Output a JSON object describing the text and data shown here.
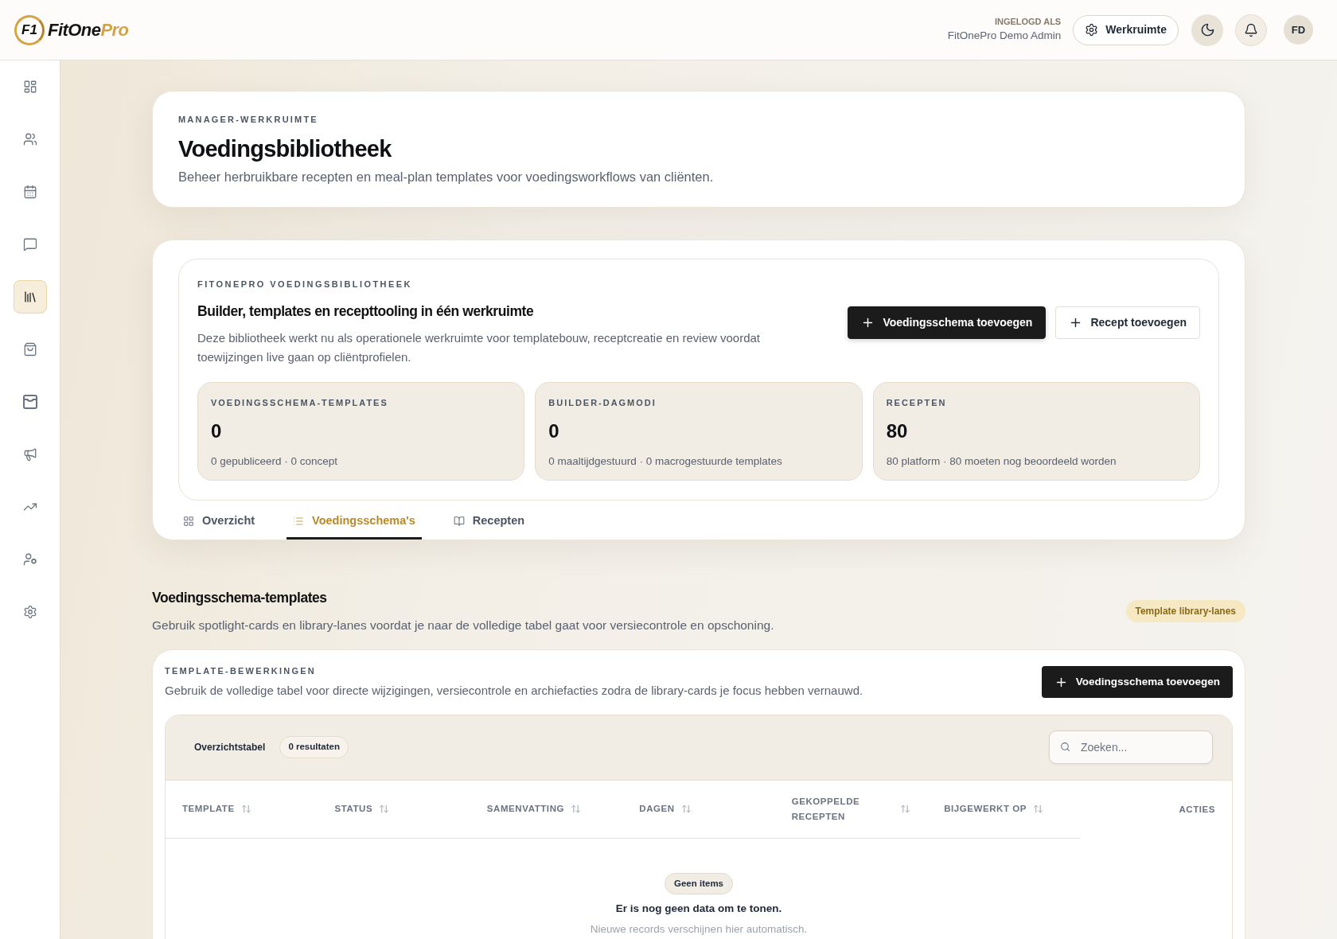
{
  "brand": {
    "mark": "F1",
    "name": "FitOne",
    "accent": "Pro"
  },
  "user": {
    "label": "INGELOGD ALS",
    "name": "FitOnePro Demo Admin"
  },
  "top_actions": {
    "workspace_button": "Werkruimte",
    "avatar": "FD"
  },
  "sidebar": {
    "items": [
      {
        "selected": false
      },
      {
        "selected": false
      },
      {
        "selected": false
      },
      {
        "selected": false
      },
      {
        "selected": true
      },
      {
        "selected": false
      },
      {
        "selected": false
      },
      {
        "selected": false
      },
      {
        "selected": false
      },
      {
        "selected": false
      },
      {
        "selected": false
      }
    ]
  },
  "page_header": {
    "eyebrow": "MANAGER-WERKRUIMTE",
    "title": "Voedingsbibliotheek",
    "subtitle": "Beheer herbruikbare recepten en meal-plan templates voor voedingsworkflows van cliënten."
  },
  "library_panel": {
    "eyebrow": "FITONEPRO VOEDINGSBIBLIOTHEEK",
    "title": "Builder, templates en recepttooling in één werkruimte",
    "description": "Deze bibliotheek werkt nu als operationele werkruimte voor templatebouw, receptcreatie en review voordat toewijzingen live gaan op cliëntprofielen.",
    "buttons": [
      {
        "label": "Voedingsschema toevoegen",
        "kind": "primary"
      },
      {
        "label": "Recept toevoegen",
        "kind": "secondary"
      }
    ],
    "stats": [
      {
        "label": "VOEDINGSSCHEMA-TEMPLATES",
        "value": "0",
        "detail": "0 gepubliceerd · 0 concept"
      },
      {
        "label": "BUILDER-DAGMODI",
        "value": "0",
        "detail": "0 maaltijdgestuurd · 0 macrogestuurde templates"
      },
      {
        "label": "RECEPTEN",
        "value": "80",
        "detail": "80 platform · 80 moeten nog beoordeeld worden"
      }
    ],
    "tabs": [
      {
        "label": "Overzicht",
        "selected": false
      },
      {
        "label": "Voedingsschema's",
        "selected": true
      },
      {
        "label": "Recepten",
        "selected": false
      }
    ]
  },
  "section": {
    "title": "Voedingsschema-templates",
    "description": "Gebruik spotlight-cards en library-lanes voordat je naar de volledige tabel gaat voor versiecontrole en opschoning.",
    "badge": "Template library-lanes"
  },
  "template_card": {
    "eyebrow": "TEMPLATE-BEWERKINGEN",
    "description": "Gebruik de volledige tabel voor directe wijzigingen, versiecontrole en archiefacties zodra de library-cards je focus hebben vernauwd.",
    "button": "Voedingsschema toevoegen",
    "table": {
      "title": "Overzichtstabel",
      "count": "0 resultaten",
      "search": {
        "placeholder": "Zoeken..."
      },
      "columns": [
        {
          "label": "TEMPLATE",
          "sortable": true
        },
        {
          "label": "STATUS",
          "sortable": true
        },
        {
          "label": "SAMENVATTING",
          "sortable": true
        },
        {
          "label": "DAGEN",
          "sortable": true
        },
        {
          "label": "GEKOPPELDE RECEPTEN",
          "sortable": true
        },
        {
          "label": "BIJGEWERKT OP",
          "sortable": true
        },
        {
          "label": "ACTIES",
          "sortable": false
        }
      ],
      "empty": {
        "badge": "Geen items",
        "title": "Er is nog geen data om te tonen.",
        "hint": "Nieuwe records verschijnen hier automatisch."
      }
    }
  }
}
